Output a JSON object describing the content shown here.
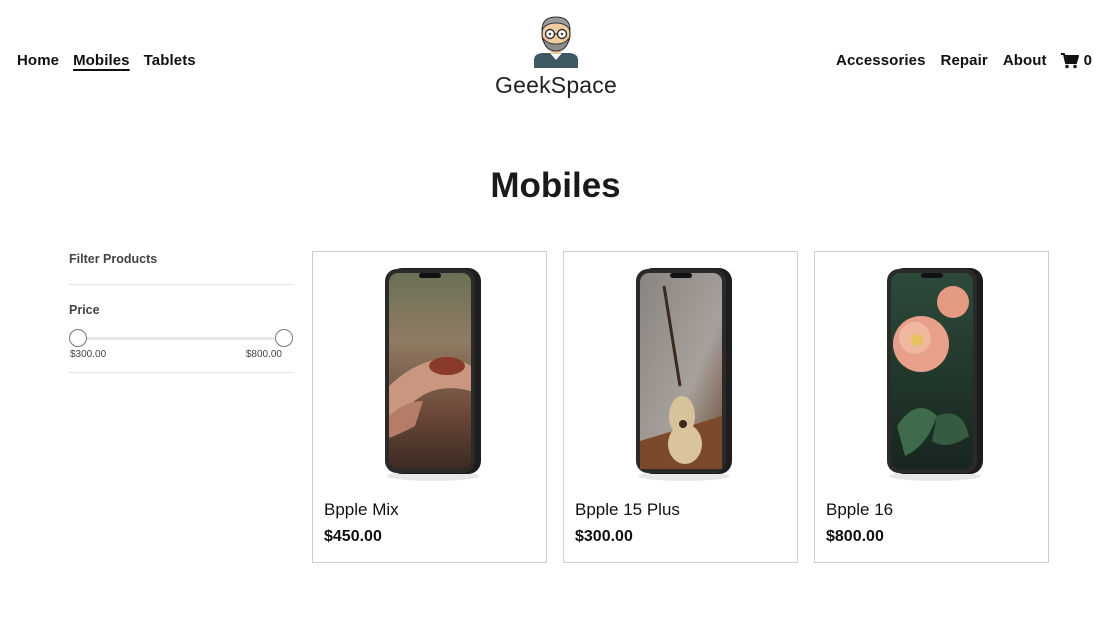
{
  "brand": {
    "name": "GeekSpace",
    "logo_icon": "geek-avatar-icon"
  },
  "nav": {
    "left": [
      {
        "label": "Home",
        "active": false
      },
      {
        "label": "Mobiles",
        "active": true
      },
      {
        "label": "Tablets",
        "active": false
      }
    ],
    "right": [
      {
        "label": "Accessories"
      },
      {
        "label": "Repair"
      },
      {
        "label": "About"
      }
    ],
    "cart": {
      "icon": "cart-icon",
      "count": "0"
    }
  },
  "page": {
    "title": "Mobiles"
  },
  "filters": {
    "title": "Filter Products",
    "price": {
      "label": "Price",
      "min_label": "$300.00",
      "max_label": "$800.00"
    }
  },
  "products": [
    {
      "name": "Bpple Mix",
      "price": "$450.00",
      "screen": "hand-with-ring-photo"
    },
    {
      "name": "Bpple 15 Plus",
      "price": "$300.00",
      "screen": "acoustic-guitar-photo"
    },
    {
      "name": "Bpple 16",
      "price": "$800.00",
      "screen": "peony-flower-photo"
    }
  ],
  "colors": {
    "text": "#111111",
    "border": "#cfcfcf",
    "divider": "#e2e2e2"
  }
}
